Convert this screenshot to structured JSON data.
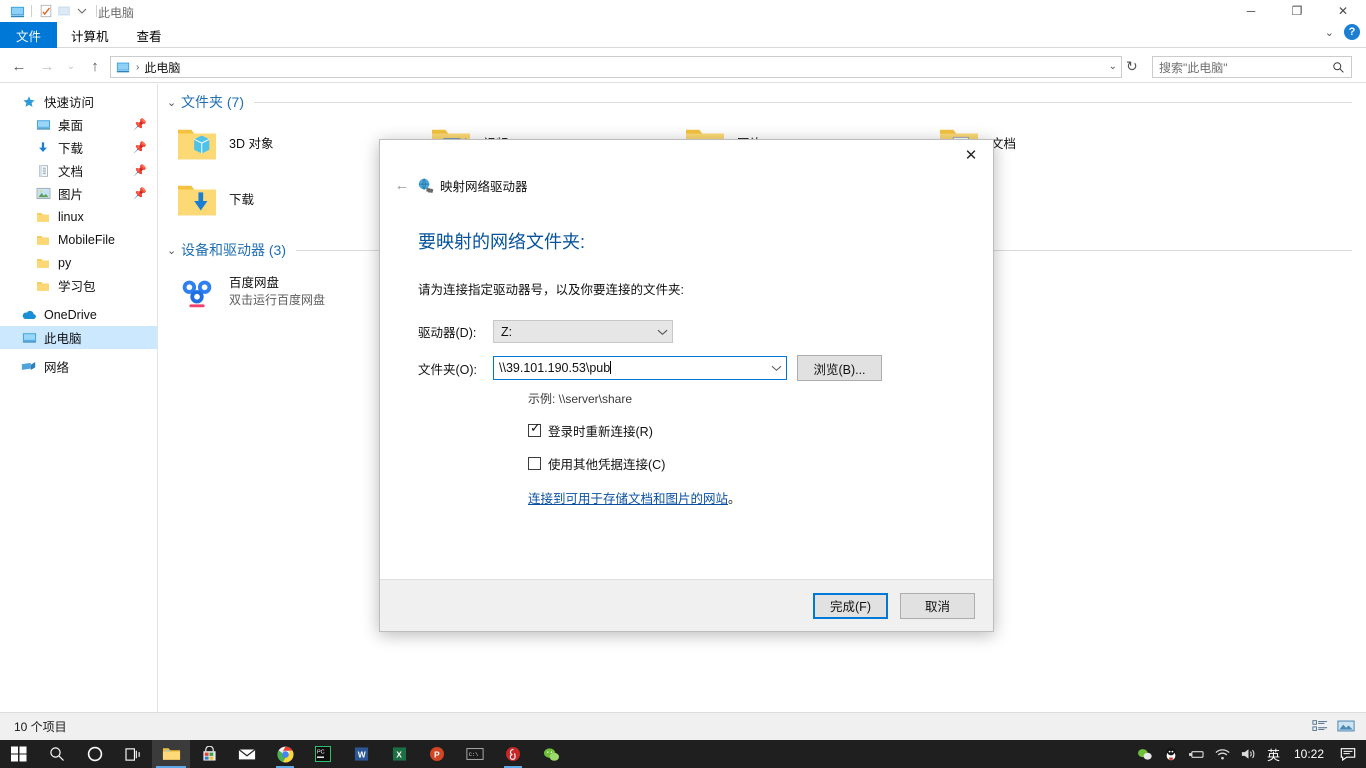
{
  "window": {
    "title": "此电脑",
    "quick_access_icons": [
      "pc-icon",
      "properties-icon",
      "new-folder-icon",
      "customize-dropdown-icon"
    ],
    "controls": {
      "minimize": "─",
      "maximize": "❐",
      "close": "✕"
    },
    "ribbon_collapse": "⌄",
    "help": "?"
  },
  "ribbon": {
    "tabs": [
      {
        "label": "文件",
        "name": "tab-file",
        "active": true
      },
      {
        "label": "计算机",
        "name": "tab-computer",
        "active": false
      },
      {
        "label": "查看",
        "name": "tab-view",
        "active": false
      }
    ]
  },
  "navbar": {
    "back": "←",
    "forward": "→",
    "recent": "⌄",
    "up": "↑",
    "breadcrumb_icon": "pc-icon",
    "breadcrumb": "此电脑",
    "breadcrumb_sep": "›",
    "address_dropdown": "⌄",
    "refresh": "↻",
    "search_placeholder": "搜索\"此电脑\"",
    "search_icon": "search-icon"
  },
  "sidebar": {
    "items": [
      {
        "label": "快速访问",
        "icon": "star-icon",
        "level": 1,
        "pinned": false,
        "selected": false
      },
      {
        "label": "桌面",
        "icon": "desktop-icon",
        "level": 2,
        "pinned": true,
        "selected": false
      },
      {
        "label": "下载",
        "icon": "downloads-icon",
        "level": 2,
        "pinned": true,
        "selected": false
      },
      {
        "label": "文档",
        "icon": "documents-icon",
        "level": 2,
        "pinned": true,
        "selected": false
      },
      {
        "label": "图片",
        "icon": "pictures-icon",
        "level": 2,
        "pinned": true,
        "selected": false
      },
      {
        "label": "linux",
        "icon": "folder-icon",
        "level": 2,
        "pinned": false,
        "selected": false
      },
      {
        "label": "MobileFile",
        "icon": "folder-icon",
        "level": 2,
        "pinned": false,
        "selected": false
      },
      {
        "label": "py",
        "icon": "folder-icon",
        "level": 2,
        "pinned": false,
        "selected": false
      },
      {
        "label": "学习包",
        "icon": "folder-icon",
        "level": 2,
        "pinned": false,
        "selected": false
      },
      {
        "label": "OneDrive",
        "icon": "onedrive-icon",
        "level": 1,
        "pinned": false,
        "selected": false
      },
      {
        "label": "此电脑",
        "icon": "pc-icon",
        "level": 1,
        "pinned": false,
        "selected": true
      },
      {
        "label": "网络",
        "icon": "network-icon",
        "level": 1,
        "pinned": false,
        "selected": false
      }
    ]
  },
  "content": {
    "groups": [
      {
        "title": "文件夹 (7)",
        "name": "group-folders",
        "items": [
          {
            "label": "3D 对象",
            "icon": "folder-3d-icon",
            "sub": ""
          },
          {
            "label": "视频",
            "icon": "folder-videos-icon",
            "sub": ""
          },
          {
            "label": "图片",
            "icon": "folder-pictures-icon",
            "sub": ""
          },
          {
            "label": "文档",
            "icon": "folder-documents-icon",
            "sub": ""
          },
          {
            "label": "下载",
            "icon": "folder-downloads-icon",
            "sub": ""
          }
        ]
      },
      {
        "title": "设备和驱动器 (3)",
        "name": "group-devices",
        "items": [
          {
            "label": "百度网盘",
            "icon": "baidu-netdisk-icon",
            "sub": "双击运行百度网盘"
          }
        ]
      }
    ]
  },
  "statusbar": {
    "item_count": "10 个项目",
    "view_details_icon": "details-view-icon",
    "view_large_icon": "large-icons-view-icon"
  },
  "dialog": {
    "close": "✕",
    "back": "←",
    "icon": "map-network-drive-icon",
    "title": "映射网络驱动器",
    "heading": "要映射的网络文件夹:",
    "description": "请为连接指定驱动器号，以及你要连接的文件夹:",
    "drive_label": "驱动器(D):",
    "drive_value": "Z:",
    "drive_dropdown_icon": "chevron-down-icon",
    "folder_label": "文件夹(O):",
    "folder_value": "\\\\39.101.190.53\\pub",
    "folder_dropdown_icon": "chevron-down-icon",
    "browse_button": "浏览(B)...",
    "example_hint": "示例: \\\\server\\share",
    "checkboxes": [
      {
        "label": "登录时重新连接(R)",
        "checked": true,
        "name": "reconnect-checkbox"
      },
      {
        "label": "使用其他凭据连接(C)",
        "checked": false,
        "name": "other-credentials-checkbox"
      }
    ],
    "link_text": "连接到可用于存储文档和图片的网站",
    "link_suffix": "。",
    "finish_button": "完成(F)",
    "cancel_button": "取消"
  },
  "taskbar": {
    "start_icon": "windows-start-icon",
    "items": [
      {
        "name": "taskbar-search",
        "icon": "search-icon",
        "state": "idle"
      },
      {
        "name": "taskbar-cortana",
        "icon": "cortana-icon",
        "state": "idle"
      },
      {
        "name": "taskbar-task-view",
        "icon": "task-view-icon",
        "state": "idle"
      },
      {
        "name": "taskbar-file-explorer",
        "icon": "file-explorer-icon",
        "state": "active"
      },
      {
        "name": "taskbar-microsoft-store",
        "icon": "store-icon",
        "state": "idle"
      },
      {
        "name": "taskbar-mail",
        "icon": "mail-icon",
        "state": "idle"
      },
      {
        "name": "taskbar-chrome",
        "icon": "chrome-icon",
        "state": "running"
      },
      {
        "name": "taskbar-pycharm",
        "icon": "pycharm-icon",
        "state": "idle"
      },
      {
        "name": "taskbar-word",
        "icon": "word-icon",
        "state": "idle"
      },
      {
        "name": "taskbar-excel",
        "icon": "excel-icon",
        "state": "idle"
      },
      {
        "name": "taskbar-powerpoint",
        "icon": "powerpoint-icon",
        "state": "idle"
      },
      {
        "name": "taskbar-cmd",
        "icon": "command-prompt-icon",
        "state": "idle"
      },
      {
        "name": "taskbar-netease-music",
        "icon": "netease-music-icon",
        "state": "running"
      },
      {
        "name": "taskbar-wechat",
        "icon": "wechat-icon",
        "state": "idle"
      }
    ],
    "tray": {
      "wechat_status_icon": "wechat-tray-icon",
      "qq_icon": "qq-tray-icon",
      "usb_icon": "usb-eject-icon",
      "network_icon": "wifi-icon",
      "volume_icon": "volume-icon",
      "ime": "英",
      "clock": "10:22",
      "action_center_icon": "action-center-icon"
    }
  },
  "colors": {
    "accent": "#0078d7",
    "heading": "#06539b",
    "link": "#0a51a1",
    "selection": "#cce8ff",
    "taskbar": "#1f1f1f"
  }
}
